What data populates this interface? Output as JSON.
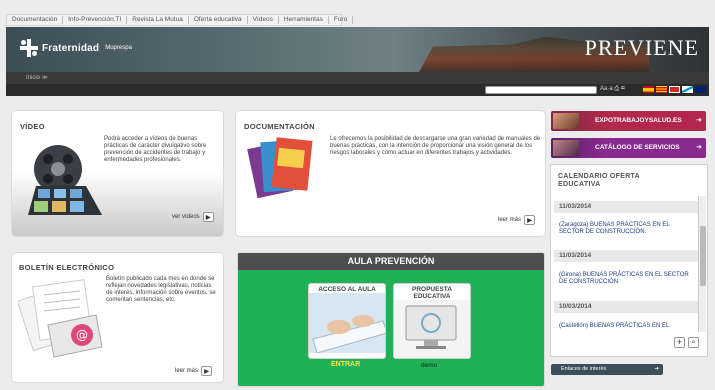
{
  "topnav": {
    "items": [
      "Documentación",
      "Info-Prevención.TI",
      "Revista La Mutua",
      "Oferta educativa",
      "Vídeos",
      "Herramientas",
      "Foro"
    ]
  },
  "header": {
    "logo_name": "Fraternidad",
    "logo_sub": "Muprespa",
    "brand": "PREVIENE"
  },
  "subbar": {
    "breadcrumb": "Inicio ≫"
  },
  "toolbar": {
    "tools_text": "Aa·a ⎙ ✉"
  },
  "video": {
    "title": "VÍDEO",
    "text": "Podrá acceder a vídeos de buenas prácticas de carácter divulgativo sobre prevención de accidentes de trabajo y enfermedades profesionales.",
    "more": "ver vídeos"
  },
  "documentacion": {
    "title": "DOCUMENTACIÓN",
    "text": "Le ofrecemos la posibilidad de descargarse una gran variedad de manuales de buenas prácticas, con la intención de proporcionar una visión general de los riesgos laborales y cómo actuar en diferentes trabajos y actividades.",
    "more": "leer más"
  },
  "boletin": {
    "title": "BOLETÍN ELECTRÓNICO",
    "text": "Boletín publicado cada mes en donde se reflejan novedades legislativas, noticias de interés, información sobre eventos, se comentan sentencias, etc.",
    "more": "leer más"
  },
  "aula": {
    "title": "AULA PREVENCIÓN",
    "acceso_label": "ACCESO AL AULA",
    "acceso_link": "ENTRAR",
    "propuesta_label": "PROPUESTA EDUCATIVA",
    "propuesta_link": "demo"
  },
  "banners": {
    "expo": "EXPOTRABAJOYSALUD.ES",
    "catalogo": "CATÁLOGO DE SERVICIOS"
  },
  "calendar": {
    "title": "CALENDARIO OFERTA EDUCATIVA",
    "events": [
      {
        "date": "11/03/2014",
        "text": "(Zaragoza) BUENAS PRÁCTICAS EN EL SECTOR DE CONSTRUCCIÓN."
      },
      {
        "date": "11/03/2014",
        "text": "(Girona) BUENAS PRÁCTICAS EN EL SECTOR DE CONSTRUCCIÓN."
      },
      {
        "date": "10/03/2014",
        "text": "(Castellón) BUENAS PRÁCTICAS EN EL"
      }
    ],
    "link": "Enlaces de interés"
  },
  "colors": {
    "header_dark": "#2b2b2b",
    "aula_green": "#1eb155",
    "expo_red": "#b1284a",
    "catalogo_purple": "#8a2a8f",
    "calendar_link": "#1b3d86"
  }
}
